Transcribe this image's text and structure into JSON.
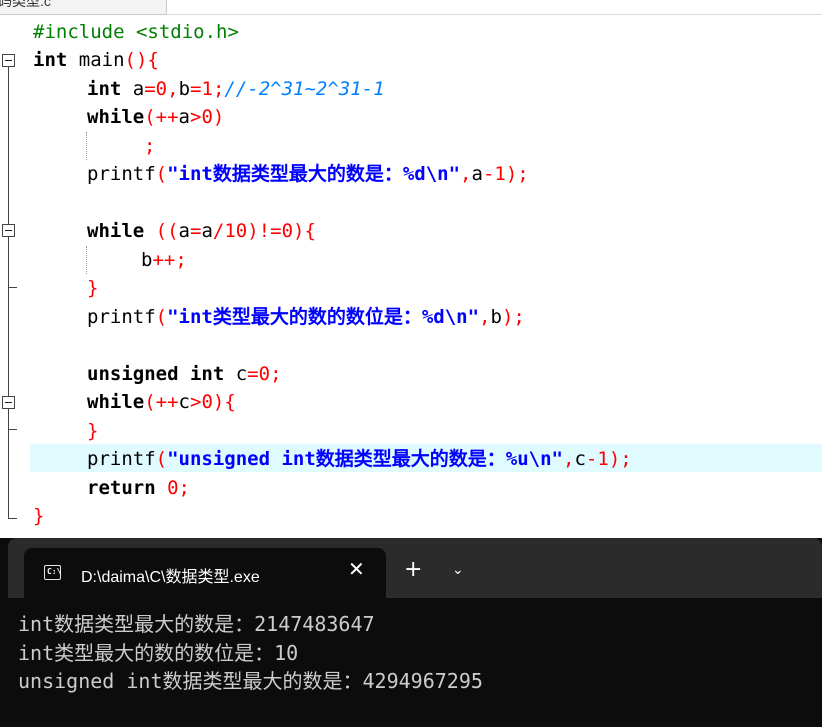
{
  "editor": {
    "tab_fragment": "码类型.c",
    "lines": {
      "l1_include": "#include <stdio.h>",
      "l2_int": "int",
      "l2_main": " main",
      "l3_int": "int",
      "l3_a": " a",
      "l3_zero": "0",
      "l3_b": "b",
      "l3_one": "1",
      "l3_comment": "//-2^31~2^31-1",
      "l4_while": "while",
      "l4_a": "a",
      "l4_zero": "0",
      "l6_printf": "printf",
      "l6_str": "\"int数据类型最大的数是：%d\\n\"",
      "l6_a": "a",
      "l6_one": "1",
      "l8_while": "while",
      "l8_a": "a",
      "l8_a2": "a",
      "l8_ten": "10",
      "l8_zero": "0",
      "l9_b": "b",
      "l11_printf": "printf",
      "l11_str": "\"int类型最大的数的数位是：%d\\n\"",
      "l11_b": "b",
      "l13_unsigned": "unsigned",
      "l13_int": "int",
      "l13_c": "c",
      "l13_zero": "0",
      "l14_while": "while",
      "l14_c": "c",
      "l14_zero": "0",
      "l16_printf": "printf",
      "l16_str": "\"unsigned int数据类型最大的数是：%u\\n\"",
      "l16_c": "c",
      "l16_one": "1",
      "l17_return": "return",
      "l17_zero": "0"
    }
  },
  "terminal": {
    "tab_title": "D:\\daima\\C\\数据类型.exe",
    "icon_text": "C:\\",
    "close_glyph": "✕",
    "new_tab_glyph": "+",
    "dropdown_glyph": "⌄",
    "output": [
      "int数据类型最大的数是：2147483647",
      "int类型最大的数的数位是：10",
      "unsigned int数据类型最大的数是：4294967295"
    ]
  },
  "colors": {
    "keyword": "#000000",
    "preprocessor": "#008000",
    "symbol": "#ff0000",
    "comment": "#0080ff",
    "string": "#0000ff",
    "current_line": "#e0fbff",
    "terminal_bg": "#0c0c0c"
  }
}
